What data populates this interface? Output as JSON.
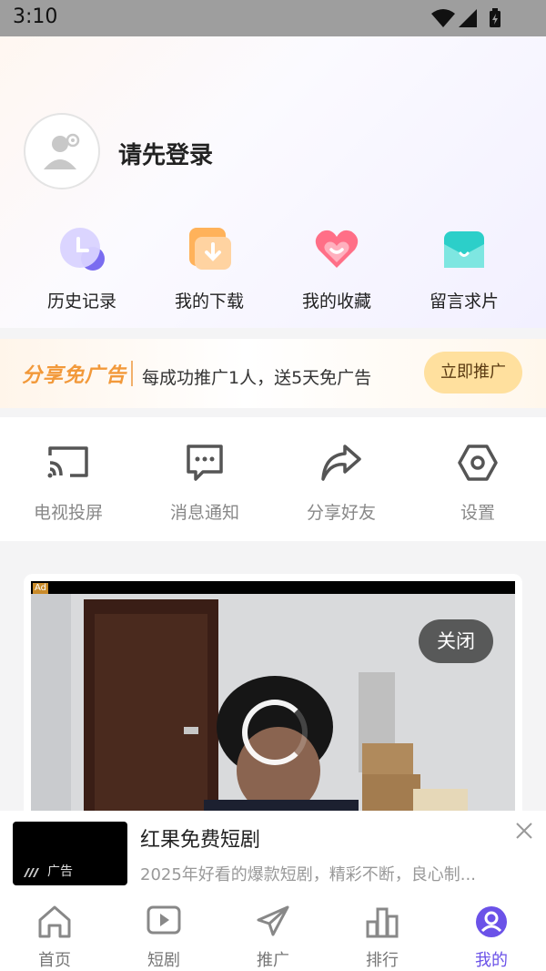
{
  "status_bar": {
    "time": "3:10",
    "icons": [
      "wifi-icon",
      "signal-icon",
      "battery-icon"
    ]
  },
  "profile": {
    "login_prompt": "请先登录"
  },
  "quick_actions": [
    {
      "label": "历史记录",
      "icon": "history-icon"
    },
    {
      "label": "我的下载",
      "icon": "download-icon"
    },
    {
      "label": "我的收藏",
      "icon": "favorite-icon"
    },
    {
      "label": "留言求片",
      "icon": "message-request-icon"
    }
  ],
  "promo": {
    "logo_text": "分享免广告",
    "text": "每成功推广1人，送5天免广告",
    "button_label": "立即推广",
    "accent_color": "#f2993a"
  },
  "tools": [
    {
      "label": "电视投屏",
      "icon": "cast-icon"
    },
    {
      "label": "消息通知",
      "icon": "message-icon"
    },
    {
      "label": "分享好友",
      "icon": "share-icon"
    },
    {
      "label": "设置",
      "icon": "settings-icon"
    }
  ],
  "ad_card": {
    "tag": "Ad",
    "close_label": "关闭"
  },
  "ad_banner": {
    "thumb_label": "广告",
    "title": "红果免费短剧",
    "description": "2025年好看的爆款短剧，精彩不断，良心制..."
  },
  "tab_bar": {
    "active_color": "#6b52e8",
    "items": [
      {
        "label": "首页",
        "icon": "home-icon",
        "active": false
      },
      {
        "label": "短剧",
        "icon": "video-icon",
        "active": false
      },
      {
        "label": "推广",
        "icon": "send-icon",
        "active": false
      },
      {
        "label": "排行",
        "icon": "ranking-icon",
        "active": false
      },
      {
        "label": "我的",
        "icon": "profile-icon",
        "active": true
      }
    ]
  }
}
